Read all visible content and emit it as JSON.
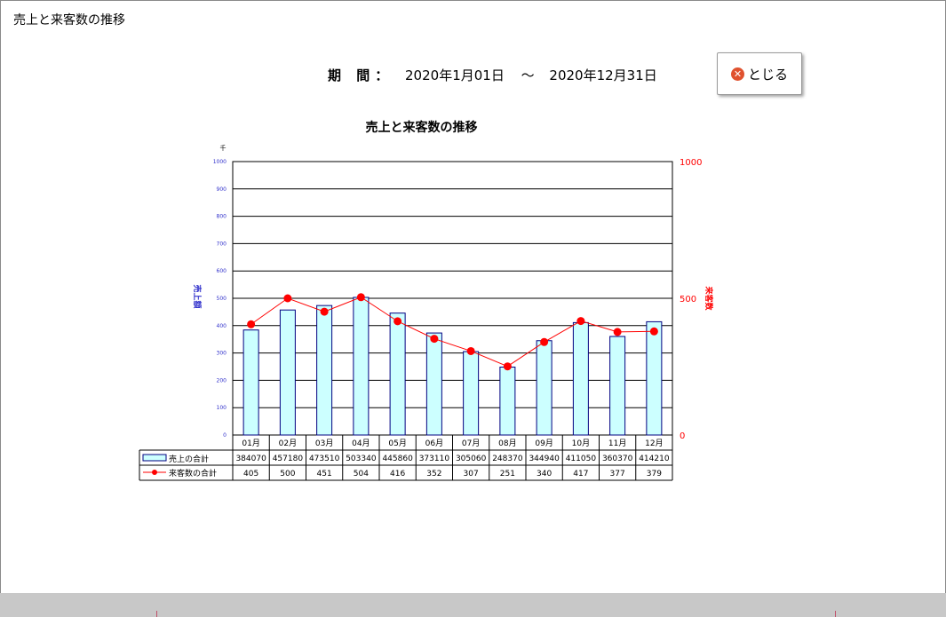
{
  "window": {
    "title": "売上と来客数の推移"
  },
  "period": {
    "label": "期 間：",
    "start": "2020年1月01日",
    "separator": "〜",
    "end": "2020年12月31日"
  },
  "close_button": {
    "label": "とじる"
  },
  "chart_data": {
    "type": "bar",
    "title": "売上と来客数の推移",
    "categories": [
      "01月",
      "02月",
      "03月",
      "04月",
      "05月",
      "06月",
      "07月",
      "08月",
      "09月",
      "10月",
      "11月",
      "12月"
    ],
    "y_unit_label": "千",
    "ylabel": "売上額",
    "ylabel2": "来客数",
    "ylim": [
      0,
      1000
    ],
    "yticks": [
      0,
      100,
      200,
      300,
      400,
      500,
      600,
      700,
      800,
      900,
      1000
    ],
    "ylim2": [
      0,
      1000
    ],
    "yticks2": [
      0,
      500,
      1000
    ],
    "grid": true,
    "series": [
      {
        "name": "売上の合計",
        "type": "bar",
        "axis": "left",
        "scale": 1000,
        "values": [
          384070,
          457180,
          473510,
          503340,
          445860,
          373110,
          305060,
          248370,
          344940,
          411050,
          360370,
          414210
        ]
      },
      {
        "name": "来客数の合計",
        "type": "line",
        "axis": "right",
        "values": [
          405,
          500,
          451,
          504,
          416,
          352,
          307,
          251,
          340,
          417,
          377,
          379
        ]
      }
    ],
    "legend": "data-table-below",
    "colors": {
      "bar_fill": "#ccffff",
      "bar_stroke": "#000080",
      "line": "#ff0000",
      "left_axis_text": "#3333cc",
      "right_axis_text": "#ff0000"
    }
  }
}
